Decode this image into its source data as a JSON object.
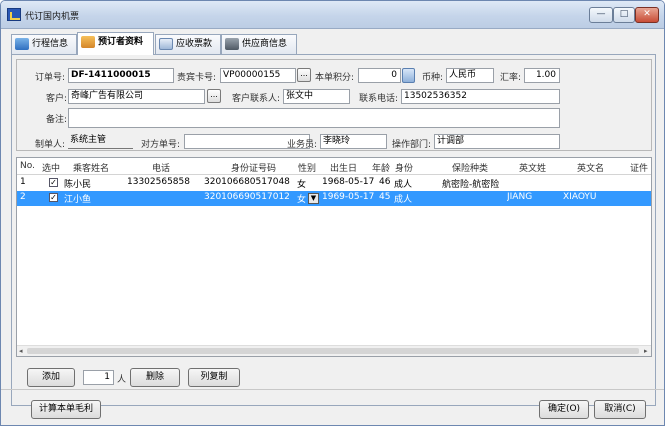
{
  "window": {
    "title": "代订国内机票",
    "min_label": "—",
    "max_label": "□",
    "close_label": "✕"
  },
  "tabs": [
    {
      "label": "行程信息"
    },
    {
      "label": "预订者资料"
    },
    {
      "label": "应收票款"
    },
    {
      "label": "供应商信息"
    }
  ],
  "form": {
    "order_no": {
      "label": "订单号:",
      "value": "DF-1411000015"
    },
    "vip_card": {
      "label": "贵宾卡号:",
      "value": "VP00000155",
      "button": "..."
    },
    "points": {
      "label": "本单积分:",
      "value": "0"
    },
    "currency": {
      "label": "币种:",
      "value": "人民币"
    },
    "exchange_rate": {
      "label": "汇率:",
      "value": "1.00"
    },
    "customer": {
      "label": "客户:",
      "value": "奇峰广告有限公司",
      "button": "..."
    },
    "contact": {
      "label": "客户联系人:",
      "value": "张文中"
    },
    "phone": {
      "label": "联系电话:",
      "value": "13502536352"
    },
    "remark": {
      "label": "备注:",
      "value": ""
    },
    "creator": {
      "label": "制单人:",
      "value": "系统主管"
    },
    "counter_order": {
      "label": "对方单号:",
      "value": ""
    },
    "salesman": {
      "label": "业务员:",
      "value": "李晓玲"
    },
    "dept": {
      "label": "操作部门:",
      "value": "计调部"
    }
  },
  "grid": {
    "columns": [
      "No.",
      "选中",
      "乘客姓名",
      "电话",
      "身份证号码",
      "性别",
      "出生日",
      "年龄",
      "身份",
      "保险种类",
      "英文姓",
      "英文名",
      "证件"
    ],
    "rows": [
      {
        "no": "1",
        "checked": "✓",
        "name": "陈小民",
        "phone": "13302565858",
        "id": "320106680517048",
        "gender": "女",
        "birth": "1968-05-17",
        "age": "46",
        "identity": "成人",
        "insurance": "航密险-航密险",
        "en_last": "",
        "en_first": ""
      },
      {
        "no": "2",
        "checked": "✓",
        "name": "江小鱼",
        "phone": "",
        "id": "320106690517012",
        "gender": "女",
        "birth": "1969-05-17",
        "age": "45",
        "identity": "成人",
        "insurance": "",
        "en_last": "JIANG",
        "en_first": "XIAOYU"
      }
    ]
  },
  "actions": {
    "add": "添加",
    "count": "1",
    "count_unit": "人",
    "delete": "删除",
    "copy": "列复制"
  },
  "footer": {
    "calc_profit": "计算本单毛利",
    "ok": "确定(O)",
    "cancel": "取消(C)"
  }
}
